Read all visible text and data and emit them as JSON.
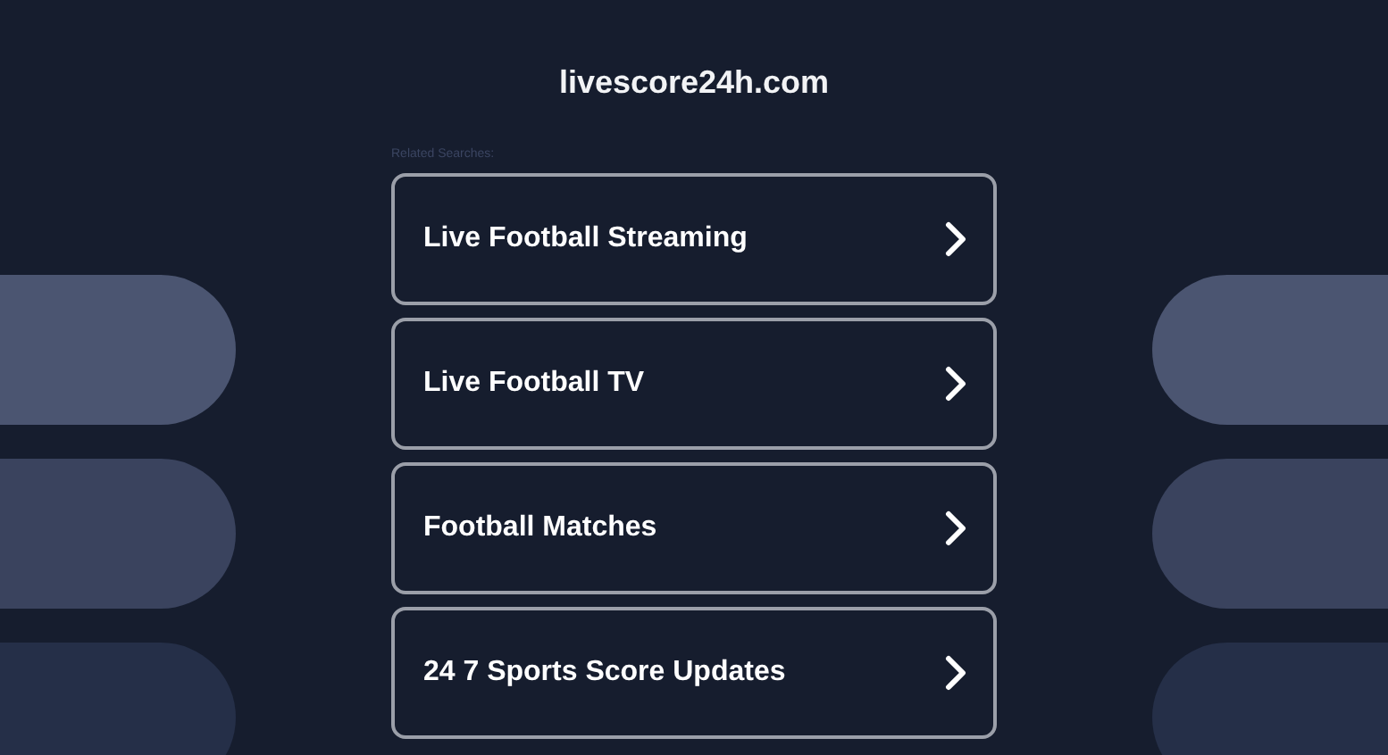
{
  "site_title": "livescore24h.com",
  "related_label": "Related Searches:",
  "links": [
    {
      "label": "Live Football Streaming"
    },
    {
      "label": "Live Football TV"
    },
    {
      "label": "Football Matches"
    },
    {
      "label": "24 7 Sports Score Updates"
    }
  ]
}
